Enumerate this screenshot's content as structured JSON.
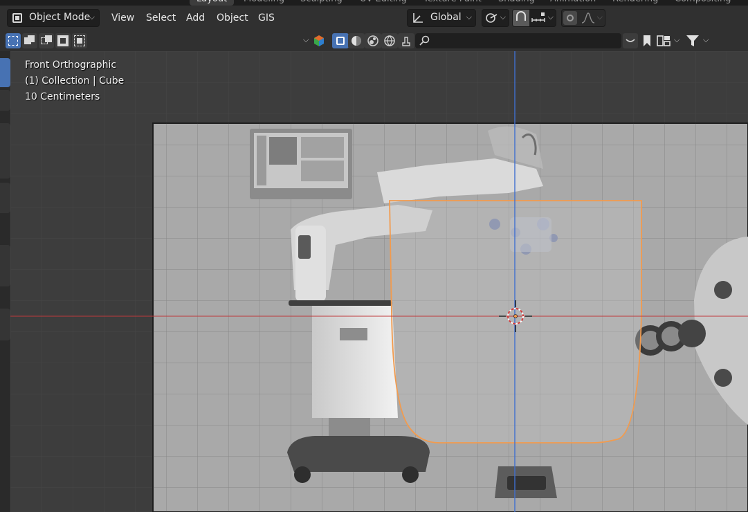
{
  "workspace_tabs": [
    "Layout",
    "Modeling",
    "Sculpting",
    "UV Editing",
    "Texture Paint",
    "Shading",
    "Animation",
    "Rendering",
    "Compositing"
  ],
  "workspace_active": "Layout",
  "header": {
    "mode_label": "Object Mode",
    "menus": {
      "view": "View",
      "select": "Select",
      "add": "Add",
      "object": "Object",
      "gis": "GIS"
    },
    "transform_orientation": "Global"
  },
  "viewport": {
    "view_name": "Front Orthographic",
    "collection_info": "(1) Collection | Cube",
    "scale_info": "10 Centimeters"
  },
  "colors": {
    "accent": "#4772b3",
    "x_axis": "#c0393b",
    "z_axis": "#3f6fd0",
    "selection_outline": "#f29b4e",
    "background": "#303030"
  },
  "icons": [
    "object-mode-icon",
    "global-orientation-icon",
    "pivot-icon",
    "snap-icon",
    "proportional-editing-icon",
    "search-icon",
    "filter-icon",
    "bookmark-icon",
    "3d-cursor-icon"
  ]
}
